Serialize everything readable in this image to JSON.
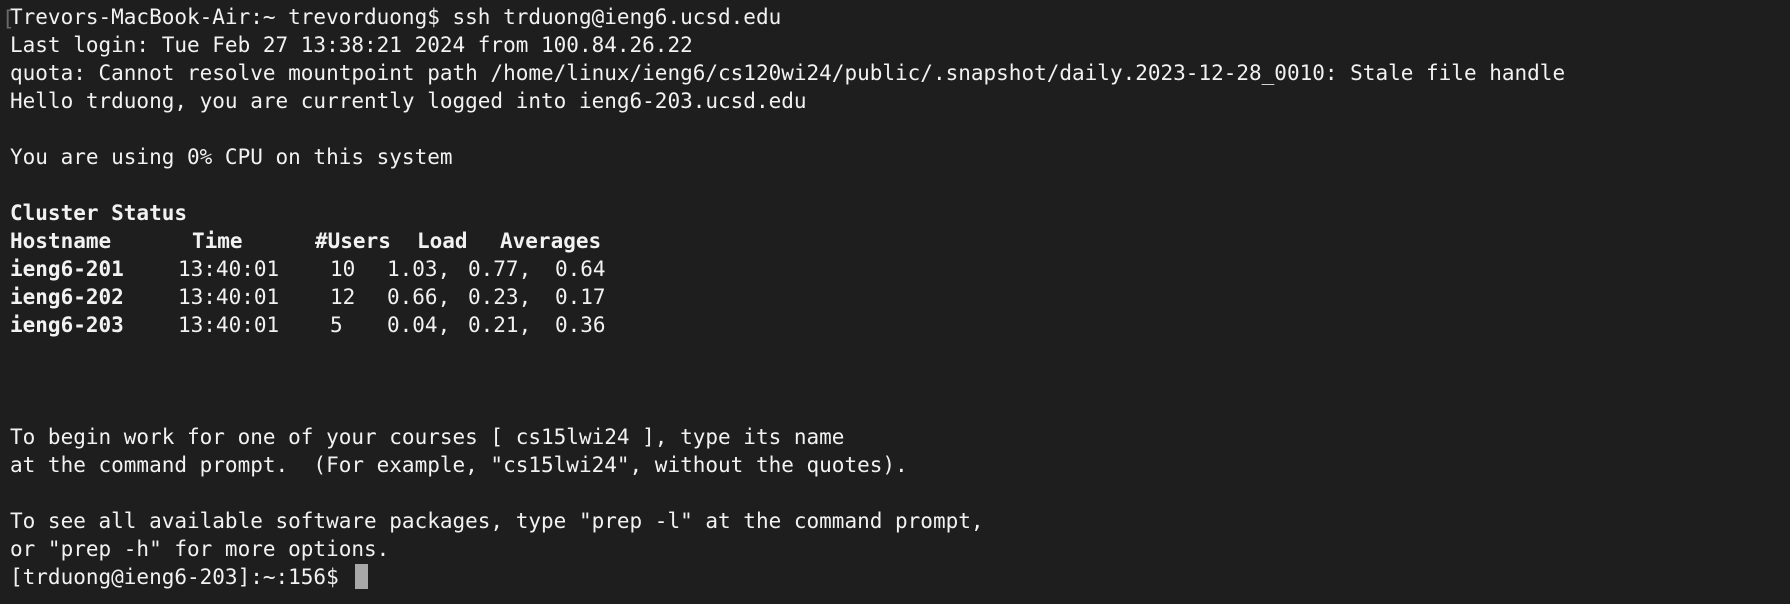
{
  "ssh_command": "Trevors-MacBook-Air:~ trevorduong$ ssh trduong@ieng6.ucsd.edu",
  "last_login": "Last login: Tue Feb 27 13:38:21 2024 from 100.84.26.22",
  "quota_error": "quota: Cannot resolve mountpoint path /home/linux/ieng6/cs120wi24/public/.snapshot/daily.2023-12-28_0010: Stale file handle",
  "hello": "Hello trduong, you are currently logged into ieng6-203.ucsd.edu",
  "cpu": "You are using 0% CPU on this system",
  "cluster": {
    "title": "Cluster Status",
    "headers": [
      "Hostname",
      "Time",
      "#Users",
      "Load",
      "Averages"
    ],
    "rows": [
      [
        "ieng6-201",
        "13:40:01",
        "10",
        "1.03,",
        "0.77,",
        "0.64"
      ],
      [
        "ieng6-202",
        "13:40:01",
        "12",
        "0.66,",
        "0.23,",
        "0.17"
      ],
      [
        "ieng6-203",
        "13:40:01",
        "5",
        "0.04,",
        "0.21,",
        "0.36"
      ]
    ]
  },
  "courses_line1": "To begin work for one of your courses [ cs15lwi24 ], type its name",
  "courses_line2": "at the command prompt.  (For example, \"cs15lwi24\", without the quotes).",
  "prep_line1": "To see all available software packages, type \"prep -l\" at the command prompt,",
  "prep_line2": "or \"prep -h\" for more options.",
  "prompt": "[trduong@ieng6-203]:~:156$",
  "colors": {
    "background": "#1e1e1e",
    "foreground": "#f2f2f2",
    "cursor": "#a8a8a8"
  }
}
